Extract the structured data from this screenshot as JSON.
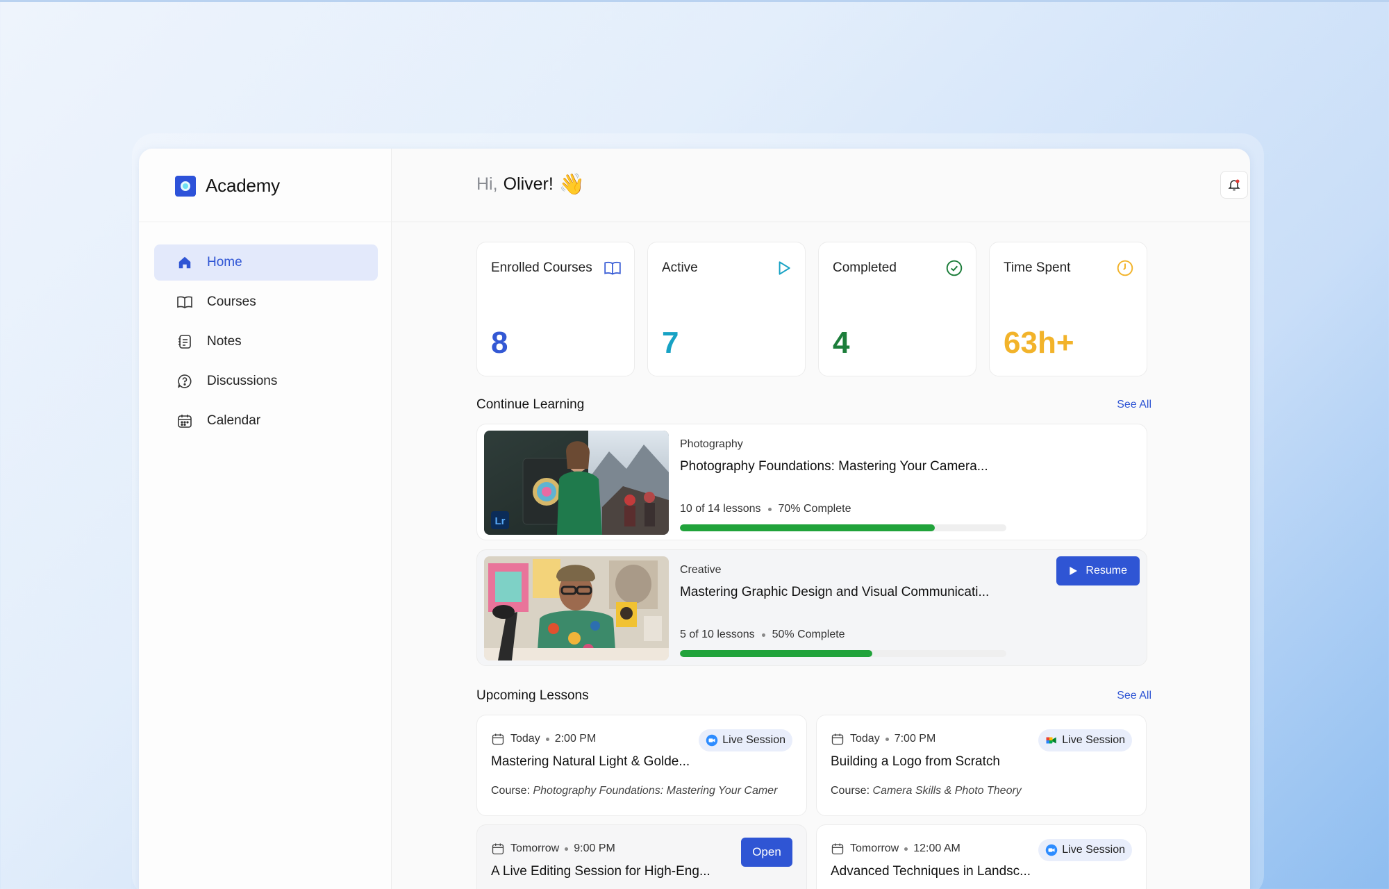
{
  "app": {
    "name": "Academy"
  },
  "sidebar": {
    "items": [
      {
        "label": "Home",
        "icon": "home-icon",
        "active": true
      },
      {
        "label": "Courses",
        "icon": "book-icon"
      },
      {
        "label": "Notes",
        "icon": "notes-icon"
      },
      {
        "label": "Discussions",
        "icon": "question-icon"
      },
      {
        "label": "Calendar",
        "icon": "calendar-icon"
      }
    ]
  },
  "header": {
    "greeting": "Hi,",
    "user_name": "Oliver!",
    "emoji": "👋"
  },
  "stats": [
    {
      "label": "Enrolled Courses",
      "value": "8",
      "icon": "book-icon",
      "color": "#3358d4"
    },
    {
      "label": "Active",
      "value": "7",
      "icon": "play-icon",
      "color": "#17a2c4"
    },
    {
      "label": "Completed",
      "value": "4",
      "icon": "check-circle-icon",
      "color": "#1c7d3a"
    },
    {
      "label": "Time Spent",
      "value": "63h+",
      "icon": "clock-icon",
      "color": "#f2b32a"
    }
  ],
  "continue_learning": {
    "title": "Continue Learning",
    "see_all": "See All",
    "courses": [
      {
        "category": "Photography",
        "title": "Photography Foundations: Mastering Your Camera...",
        "lessons": "10 of 14 lessons",
        "complete": "70% Complete",
        "progress": 0.7
      },
      {
        "category": "Creative",
        "title": "Mastering Graphic Design and Visual Communicati...",
        "lessons": "5 of 10 lessons",
        "complete": "50% Complete",
        "progress": 0.5,
        "action": "Resume"
      }
    ]
  },
  "upcoming": {
    "title": "Upcoming Lessons",
    "see_all": "See All",
    "lessons": [
      {
        "day": "Today",
        "time": "2:00 PM",
        "title": "Mastering Natural Light & Golde...",
        "course_label": "Course:",
        "course": "Photography Foundations: Mastering Your Camer",
        "badge": "Live Session"
      },
      {
        "day": "Today",
        "time": "7:00 PM",
        "title": "Building a Logo from Scratch",
        "course_label": "Course:",
        "course": "Camera Skills & Photo Theory",
        "badge": "Live Session"
      },
      {
        "day": "Tomorrow",
        "time": "9:00 PM",
        "title": "A Live Editing Session for High-Eng...",
        "action": "Open"
      },
      {
        "day": "Tomorrow",
        "time": "12:00 AM",
        "title": "Advanced Techniques in Landsc...",
        "badge": "Live Session"
      }
    ]
  },
  "thumb_badge": "Lr"
}
